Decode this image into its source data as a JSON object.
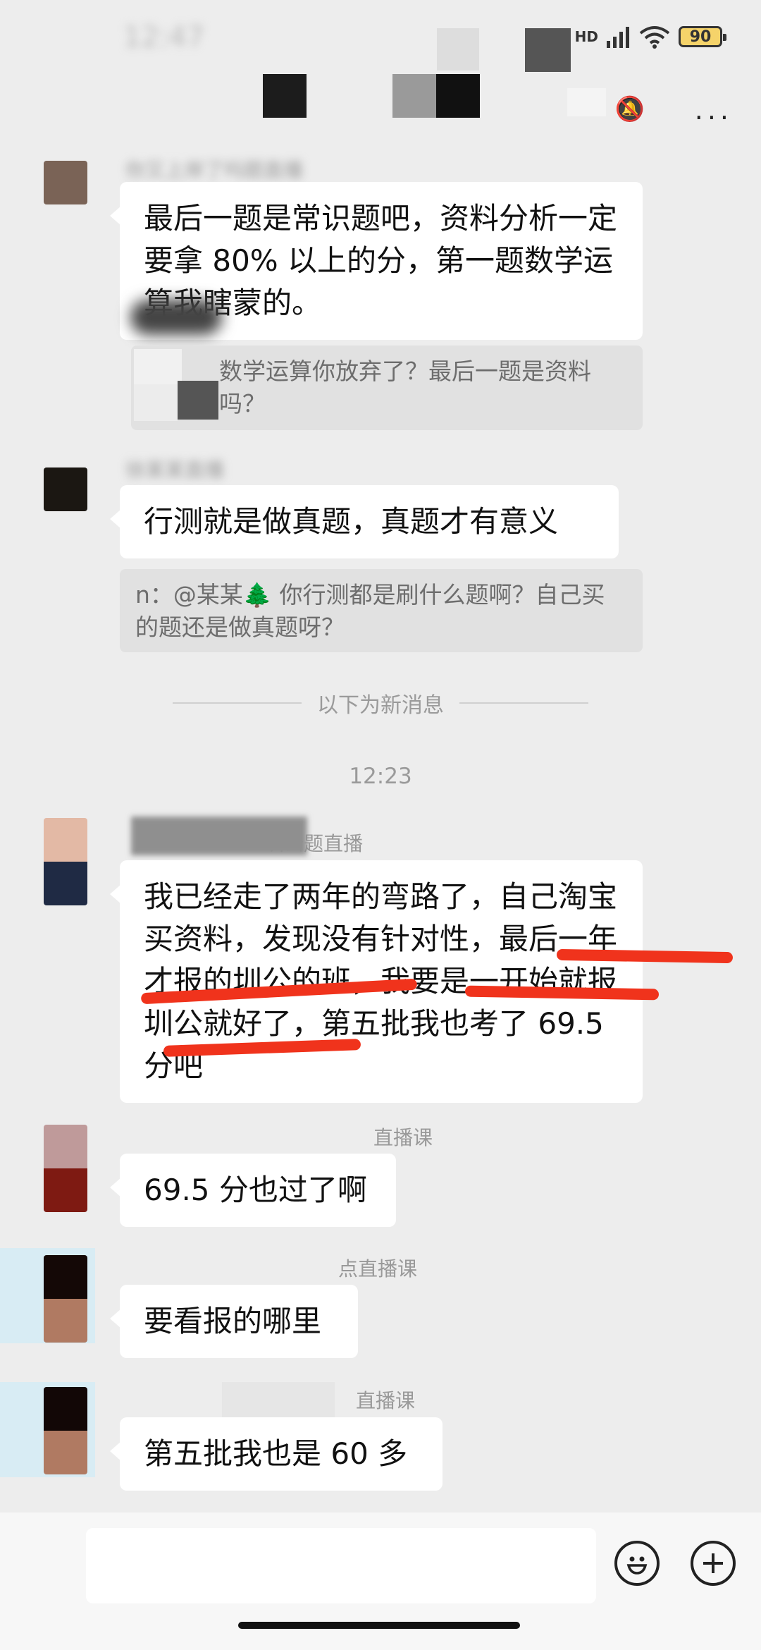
{
  "status": {
    "time": "12:47",
    "network": "HD",
    "battery": "90"
  },
  "header": {
    "more": "···"
  },
  "messages": [
    {
      "sender": "你又上岸了吗题直播",
      "text": "最后一题是常识题吧，资料分析一定要拿 80% 以上的分，第一题数学运算我瞎蒙的。",
      "quote": "数学运算你放弃了？最后一题是资料吗？"
    },
    {
      "sender": "徐某某直播",
      "text": "行测就是做真题，真题才有意义",
      "quote": "n：@某某🌲 你行测都是刷什么题啊？自己买的题还是做真题呀？"
    }
  ],
  "divider": "以下为新消息",
  "time_label": "12:23",
  "messages_new": [
    {
      "sender": "圳公题直播",
      "text": "我已经走了两年的弯路了，自己淘宝买资料，发现没有针对性，最后一年才报的圳公的班，我要是一开始就报圳公就好了，第五批我也考了 69.5 分吧"
    },
    {
      "sender": "直播课",
      "text": "69.5 分也过了啊"
    },
    {
      "sender": "点直播课",
      "text": "要看报的哪里"
    },
    {
      "sender": "直播课",
      "text": "第五批我也是 60 多"
    }
  ],
  "input": {
    "placeholder": ""
  },
  "icons": {
    "emoji": "emoji-icon",
    "plus": "plus-icon",
    "more": "more-icon",
    "mute": "mute-icon"
  }
}
